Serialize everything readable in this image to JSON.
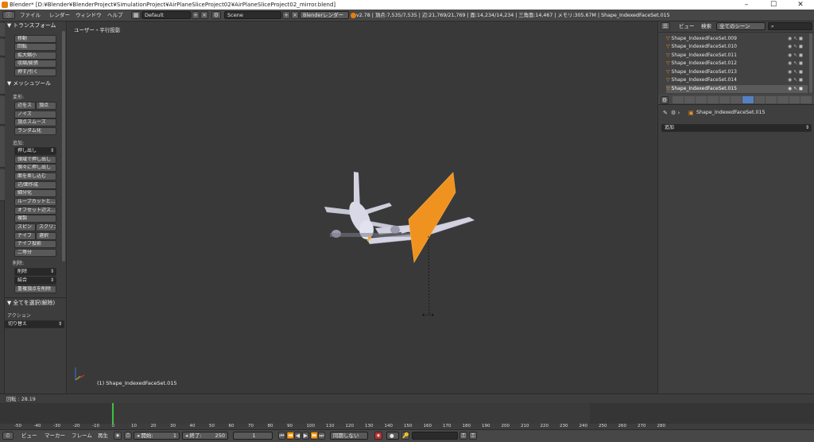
{
  "window": {
    "title": "Blender* [D:¥Blender¥BlenderProject¥SimulationProject¥AirPlaneSliceProject02¥AirPlaneSliceProject02_mirror.blend]",
    "controls": [
      "–",
      "☐",
      "✕"
    ]
  },
  "menubar": {
    "items": [
      "ファイル",
      "レンダー",
      "ウィンドウ",
      "ヘルプ"
    ],
    "layout": "Default",
    "scene": "Scene",
    "engine": "Blenderレンダー",
    "stats": "v2.78 | 頂点:7,535/7,535 | 辺:21,769/21,769 | 面:14,234/14,234 | 三角面:14,467 | メモリ:305.67M | Shape_IndexedFaceSet.015"
  },
  "toolshelf": {
    "transform": {
      "header": "▼ トランスフォーム",
      "buttons": [
        "移動",
        "回転",
        "拡大縮小",
        "収縮/膨張",
        "押す/引く"
      ]
    },
    "meshtools": {
      "header": "▼ メッシュツール",
      "deform_label": "変形:",
      "slide_edge": "辺をス",
      "slide_vertex": "頂点",
      "deform_buttons": [
        "ノイズ",
        "頂点スムーズ",
        "ランダム化"
      ],
      "add_label": "追加:",
      "extrude": "押し出し",
      "add_buttons": [
        "領域で押し出し",
        "個々に押し出し",
        "面を差し込む",
        "辺/面作成",
        "細分化",
        "ループカットと...",
        "オフセット辺ス...",
        "複製"
      ],
      "spin": "スピン",
      "screw": "スクリュ",
      "knife": "ナイフ",
      "select": "選択",
      "knife_project": "ナイフ投影",
      "bisect": "二等分",
      "remove_label": "削除:",
      "delete": "削除",
      "merge": "結合",
      "remove_doubles": "重複頂点を削除"
    },
    "lastop": {
      "header": "▼ 全てを選択(解除)",
      "action_label": "アクション",
      "action_value": "切り替え"
    },
    "tabs": [
      "ツール",
      "作成",
      "シェーディング/UV",
      "オプション",
      "グリースペンシル",
      "Mesh Tools"
    ]
  },
  "viewport": {
    "view_label": "ユーザー・平行投影",
    "object_label": "(1) Shape_IndexedFaceSet.015"
  },
  "outliner": {
    "menu_view": "ビュー",
    "menu_search": "検索",
    "scene_filter": "全てのシーン",
    "rows": [
      "Shape_IndexedFaceSet.009",
      "Shape_IndexedFaceSet.010",
      "Shape_IndexedFaceSet.011",
      "Shape_IndexedFaceSet.012",
      "Shape_IndexedFaceSet.013",
      "Shape_IndexedFaceSet.014",
      "Shape_IndexedFaceSet.015"
    ]
  },
  "properties": {
    "object_name": "Shape_IndexedFaceSet.015",
    "add_dropdown": "追加"
  },
  "timeline": {
    "status": "回転 : 28.19",
    "ruler": [
      "-50",
      "-40",
      "-30",
      "-20",
      "-10",
      "0",
      "10",
      "20",
      "30",
      "40",
      "50",
      "60",
      "70",
      "80",
      "90",
      "100",
      "110",
      "120",
      "130",
      "140",
      "150",
      "160",
      "170",
      "180",
      "190",
      "200",
      "210",
      "220",
      "230",
      "240",
      "250",
      "260",
      "270",
      "280"
    ],
    "menus": [
      "ビュー",
      "マーカー",
      "フレーム",
      "再生"
    ],
    "start_label": "◂ 開始:",
    "start_value": "1",
    "end_label": "◂ 終了:",
    "end_value": "250",
    "current_frame": "1",
    "sync": "同期しない"
  },
  "colors": {
    "accent_orange": "#f0921f",
    "playhead_green": "#40c040",
    "selection_blue": "#5680c2"
  }
}
